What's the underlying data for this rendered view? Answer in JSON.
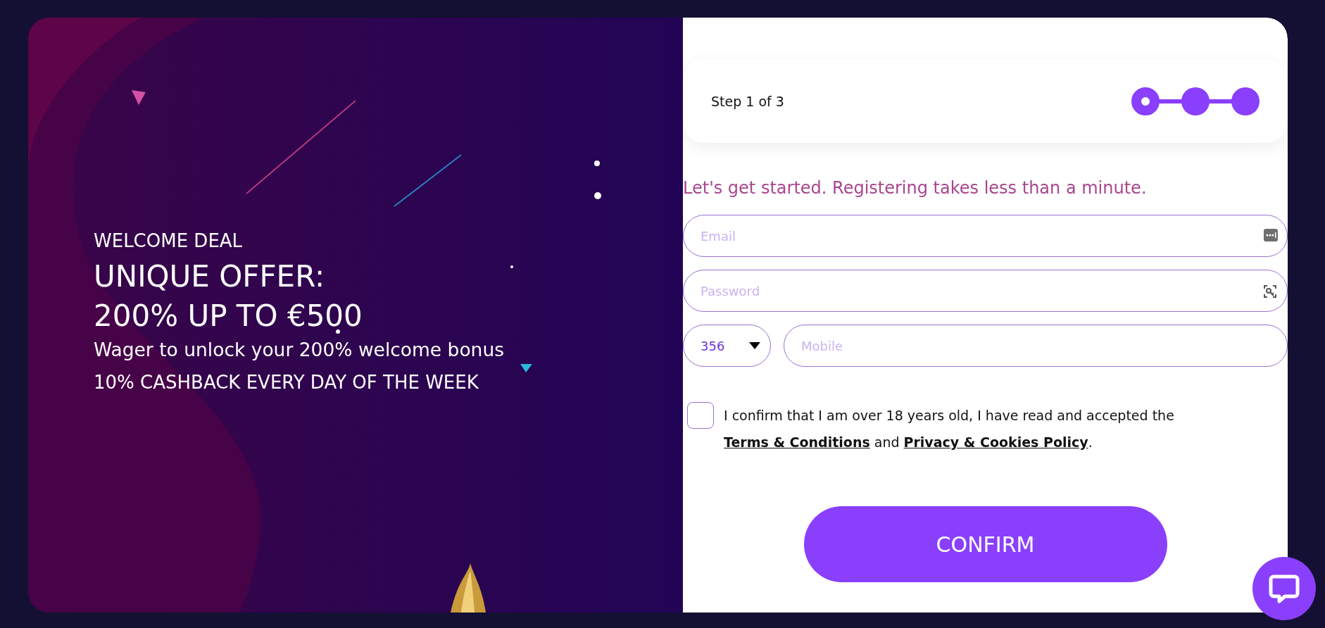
{
  "promo": {
    "background": {
      "kind": "picture"
    },
    "eyebrow": "WELCOME DEAL",
    "headline_lines": [
      "UNIQUE OFFER:",
      "200% UP TO €500"
    ],
    "subtitle": "Wager to unlock your 200% welcome bonus",
    "cashback": "10% CASHBACK EVERY DAY OF THE WEEK"
  },
  "stepper": {
    "label": "Step 1 of 3",
    "steps": [
      {
        "selected": true
      },
      {
        "selected": false
      },
      {
        "selected": false
      }
    ]
  },
  "intro": "Let's get started. Registering takes less than a minute.",
  "fields": {
    "email": {
      "placeholder": "Email"
    },
    "password": {
      "placeholder": "Password"
    },
    "country_code": {
      "value": "356"
    },
    "mobile": {
      "placeholder": "Mobile"
    }
  },
  "consent": {
    "checked": false,
    "text_before": "I confirm that I am over 18 years old, I have read and accepted the ",
    "link_terms": "Terms & Conditions",
    "text_middle": " and ",
    "link_privacy": "Privacy & Cookies Policy",
    "text_after": "."
  },
  "confirm_button": "CONFIRM"
}
